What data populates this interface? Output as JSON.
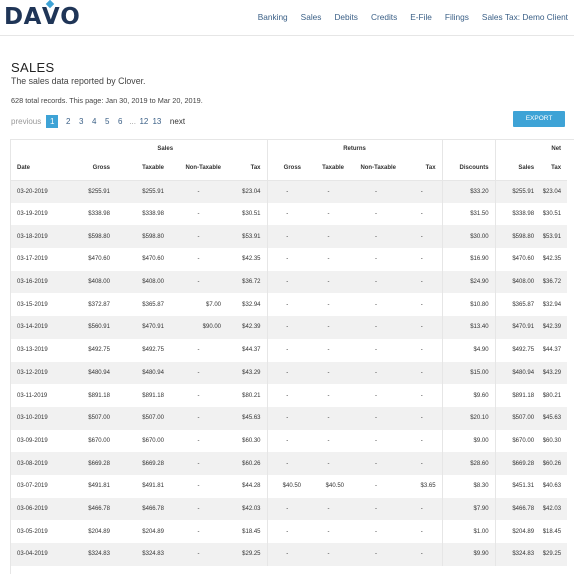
{
  "brand": "DAVO",
  "nav": [
    "Banking",
    "Sales",
    "Debits",
    "Credits",
    "E-File",
    "Filings",
    "Sales Tax: Demo Client"
  ],
  "page": {
    "title": "SALES",
    "subtitle": "The sales data reported by Clover.",
    "records": "628 total records. This page: Jan 30, 2019 to Mar 20, 2019."
  },
  "pagination": {
    "previous": "previous",
    "pages": [
      "1",
      "2",
      "3",
      "4",
      "5",
      "6"
    ],
    "ellipsis": "...",
    "last_pages": [
      "12",
      "13"
    ],
    "next": "next",
    "current": "1"
  },
  "export_label": "EXPORT",
  "table": {
    "group_headers": {
      "sales": "Sales",
      "returns": "Returns",
      "net": "Net"
    },
    "columns": [
      "Date",
      "Gross",
      "Taxable",
      "Non-Taxable",
      "Tax",
      "Gross",
      "Taxable",
      "Non-Taxable",
      "Tax",
      "Discounts",
      "Sales",
      "Tax"
    ],
    "rows": [
      [
        "03-20-2019",
        "$255.91",
        "$255.91",
        "-",
        "$23.04",
        "-",
        "-",
        "-",
        "-",
        "$33.20",
        "$255.91",
        "$23.04"
      ],
      [
        "03-19-2019",
        "$338.98",
        "$338.98",
        "-",
        "$30.51",
        "-",
        "-",
        "-",
        "-",
        "$31.50",
        "$338.98",
        "$30.51"
      ],
      [
        "03-18-2019",
        "$598.80",
        "$598.80",
        "-",
        "$53.91",
        "-",
        "-",
        "-",
        "-",
        "$30.00",
        "$598.80",
        "$53.91"
      ],
      [
        "03-17-2019",
        "$470.60",
        "$470.60",
        "-",
        "$42.35",
        "-",
        "-",
        "-",
        "-",
        "$16.90",
        "$470.60",
        "$42.35"
      ],
      [
        "03-16-2019",
        "$408.00",
        "$408.00",
        "-",
        "$36.72",
        "-",
        "-",
        "-",
        "-",
        "$24.90",
        "$408.00",
        "$36.72"
      ],
      [
        "03-15-2019",
        "$372.87",
        "$365.87",
        "$7.00",
        "$32.94",
        "-",
        "-",
        "-",
        "-",
        "$10.80",
        "$365.87",
        "$32.94"
      ],
      [
        "03-14-2019",
        "$560.91",
        "$470.91",
        "$90.00",
        "$42.39",
        "-",
        "-",
        "-",
        "-",
        "$13.40",
        "$470.91",
        "$42.39"
      ],
      [
        "03-13-2019",
        "$492.75",
        "$492.75",
        "-",
        "$44.37",
        "-",
        "-",
        "-",
        "-",
        "$4.90",
        "$492.75",
        "$44.37"
      ],
      [
        "03-12-2019",
        "$480.94",
        "$480.94",
        "-",
        "$43.29",
        "-",
        "-",
        "-",
        "-",
        "$15.00",
        "$480.94",
        "$43.29"
      ],
      [
        "03-11-2019",
        "$891.18",
        "$891.18",
        "-",
        "$80.21",
        "-",
        "-",
        "-",
        "-",
        "$9.60",
        "$891.18",
        "$80.21"
      ],
      [
        "03-10-2019",
        "$507.00",
        "$507.00",
        "-",
        "$45.63",
        "-",
        "-",
        "-",
        "-",
        "$20.10",
        "$507.00",
        "$45.63"
      ],
      [
        "03-09-2019",
        "$670.00",
        "$670.00",
        "-",
        "$60.30",
        "-",
        "-",
        "-",
        "-",
        "$9.00",
        "$670.00",
        "$60.30"
      ],
      [
        "03-08-2019",
        "$669.28",
        "$669.28",
        "-",
        "$60.26",
        "-",
        "-",
        "-",
        "-",
        "$28.60",
        "$669.28",
        "$60.26"
      ],
      [
        "03-07-2019",
        "$491.81",
        "$491.81",
        "-",
        "$44.28",
        "$40.50",
        "$40.50",
        "-",
        "$3.65",
        "$8.30",
        "$451.31",
        "$40.63"
      ],
      [
        "03-06-2019",
        "$466.78",
        "$466.78",
        "-",
        "$42.03",
        "-",
        "-",
        "-",
        "-",
        "$7.90",
        "$466.78",
        "$42.03"
      ],
      [
        "03-05-2019",
        "$204.89",
        "$204.89",
        "-",
        "$18.45",
        "-",
        "-",
        "-",
        "-",
        "$1.00",
        "$204.89",
        "$18.45"
      ],
      [
        "03-04-2019",
        "$324.83",
        "$324.83",
        "-",
        "$29.25",
        "-",
        "-",
        "-",
        "-",
        "$9.90",
        "$324.83",
        "$29.25"
      ]
    ]
  }
}
